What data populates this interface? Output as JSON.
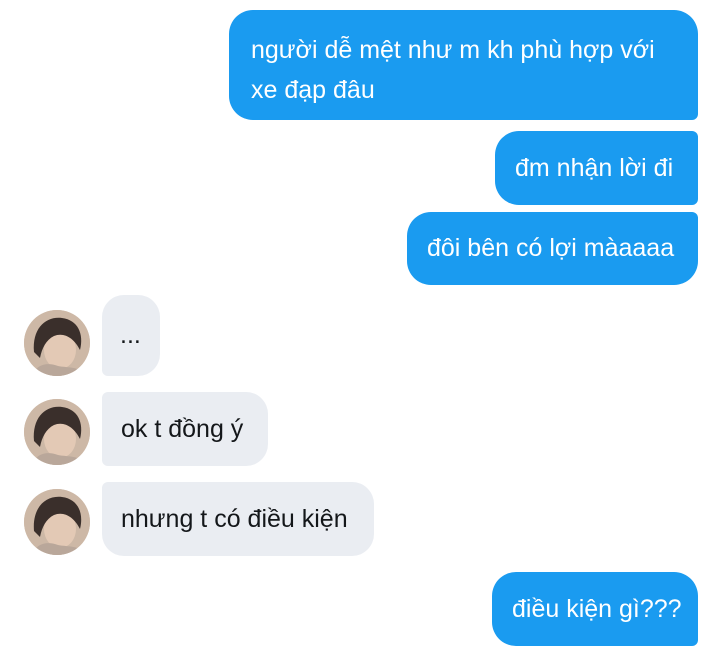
{
  "conversation": {
    "messages": [
      {
        "sender": "me",
        "text": "người dễ mệt như m kh phù hợp với xe đạp đâu",
        "line1": "người dễ mệt như m kh phù hợp với",
        "line2": "xe đạp đâu"
      },
      {
        "sender": "me",
        "text": "đm nhận lời đi"
      },
      {
        "sender": "me",
        "text": "đôi bên có lợi màaaaa"
      },
      {
        "sender": "them",
        "text": "..."
      },
      {
        "sender": "them",
        "text": "ok t đồng ý"
      },
      {
        "sender": "them",
        "text": "nhưng t có điều kiện"
      },
      {
        "sender": "me",
        "text": "điều kiện gì???"
      }
    ]
  },
  "colors": {
    "outgoing_bubble": "#1a9bf0",
    "incoming_bubble": "#eaedf2",
    "outgoing_text": "#ffffff",
    "incoming_text": "#14171a"
  },
  "icons": {
    "avatar": "profile-photo-avatar"
  }
}
